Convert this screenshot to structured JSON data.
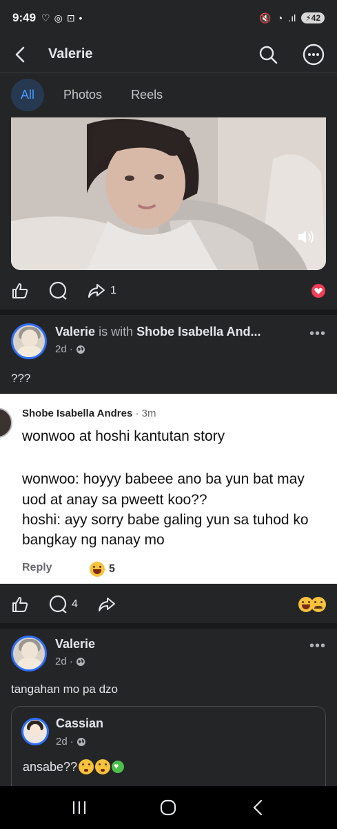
{
  "status_bar": {
    "time": "9:49",
    "battery": "42"
  },
  "header": {
    "title": "Valerie"
  },
  "tabs": [
    "All",
    "Photos",
    "Reels"
  ],
  "post1": {
    "share_count": "1"
  },
  "post2": {
    "author": "Valerie",
    "with_text": "is with",
    "tagged": "Shobe Isabella And...",
    "time": "2d",
    "text": "???",
    "screenshot": {
      "commenter": "Shobe Isabella Andres",
      "comment_time": "· 3m",
      "lines": [
        "wonwoo at hoshi kantutan story",
        "wonwoo: hoyyy babeee ano ba yun bat may",
        "uod at anay sa pweett koo??",
        "hoshi: ayy sorry babe galing yun sa tuhod ko",
        "bangkay ng nanay mo"
      ],
      "reply_label": "Reply",
      "reaction_count": "5"
    },
    "comment_count": "4"
  },
  "post3": {
    "author": "Valerie",
    "time": "2d",
    "text": "tangahan mo pa dzo",
    "shared": {
      "author": "Cassian",
      "time": "2d",
      "text": "ansabe??"
    }
  }
}
